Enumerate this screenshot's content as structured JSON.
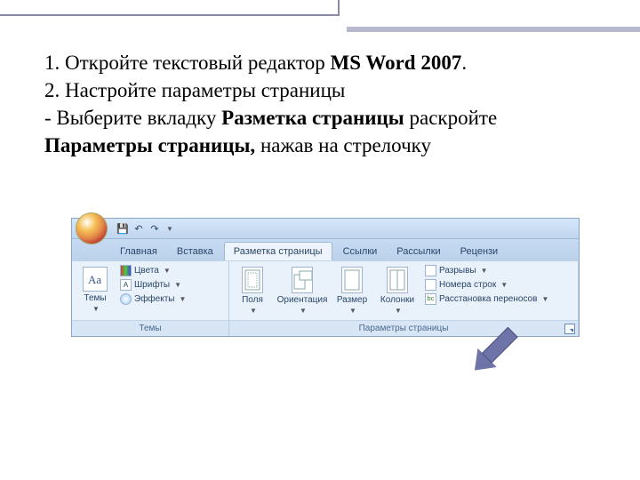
{
  "instructions": {
    "line1_a": "1. Откройте текстовый редактор ",
    "line1_b": "MS Word 2007",
    "line1_c": ".",
    "line2": "2. Настройте параметры страницы",
    "line3_a": "- Выберите вкладку ",
    "line3_b": "Разметка страницы",
    "line3_c": " раскройте ",
    "line3_d": "Параметры страницы,",
    "line3_e": " нажав на стрелочку"
  },
  "qat": {
    "save": "💾",
    "undo": "↶",
    "redo": "↷"
  },
  "tabs": {
    "home": "Главная",
    "insert": "Вставка",
    "layout": "Разметка страницы",
    "refs": "Ссылки",
    "mail": "Рассылки",
    "review": "Рецензи"
  },
  "groups": {
    "themes": {
      "title": "Темы",
      "themes_btn": "Темы",
      "colors": "Цвета",
      "fonts": "Шрифты",
      "effects": "Эффекты"
    },
    "page_setup": {
      "title": "Параметры страницы",
      "margins": "Поля",
      "orientation": "Ориентация",
      "size": "Размер",
      "columns": "Колонки",
      "breaks": "Разрывы",
      "line_numbers": "Номера строк",
      "hyphenation": "Расстановка переносов"
    }
  }
}
